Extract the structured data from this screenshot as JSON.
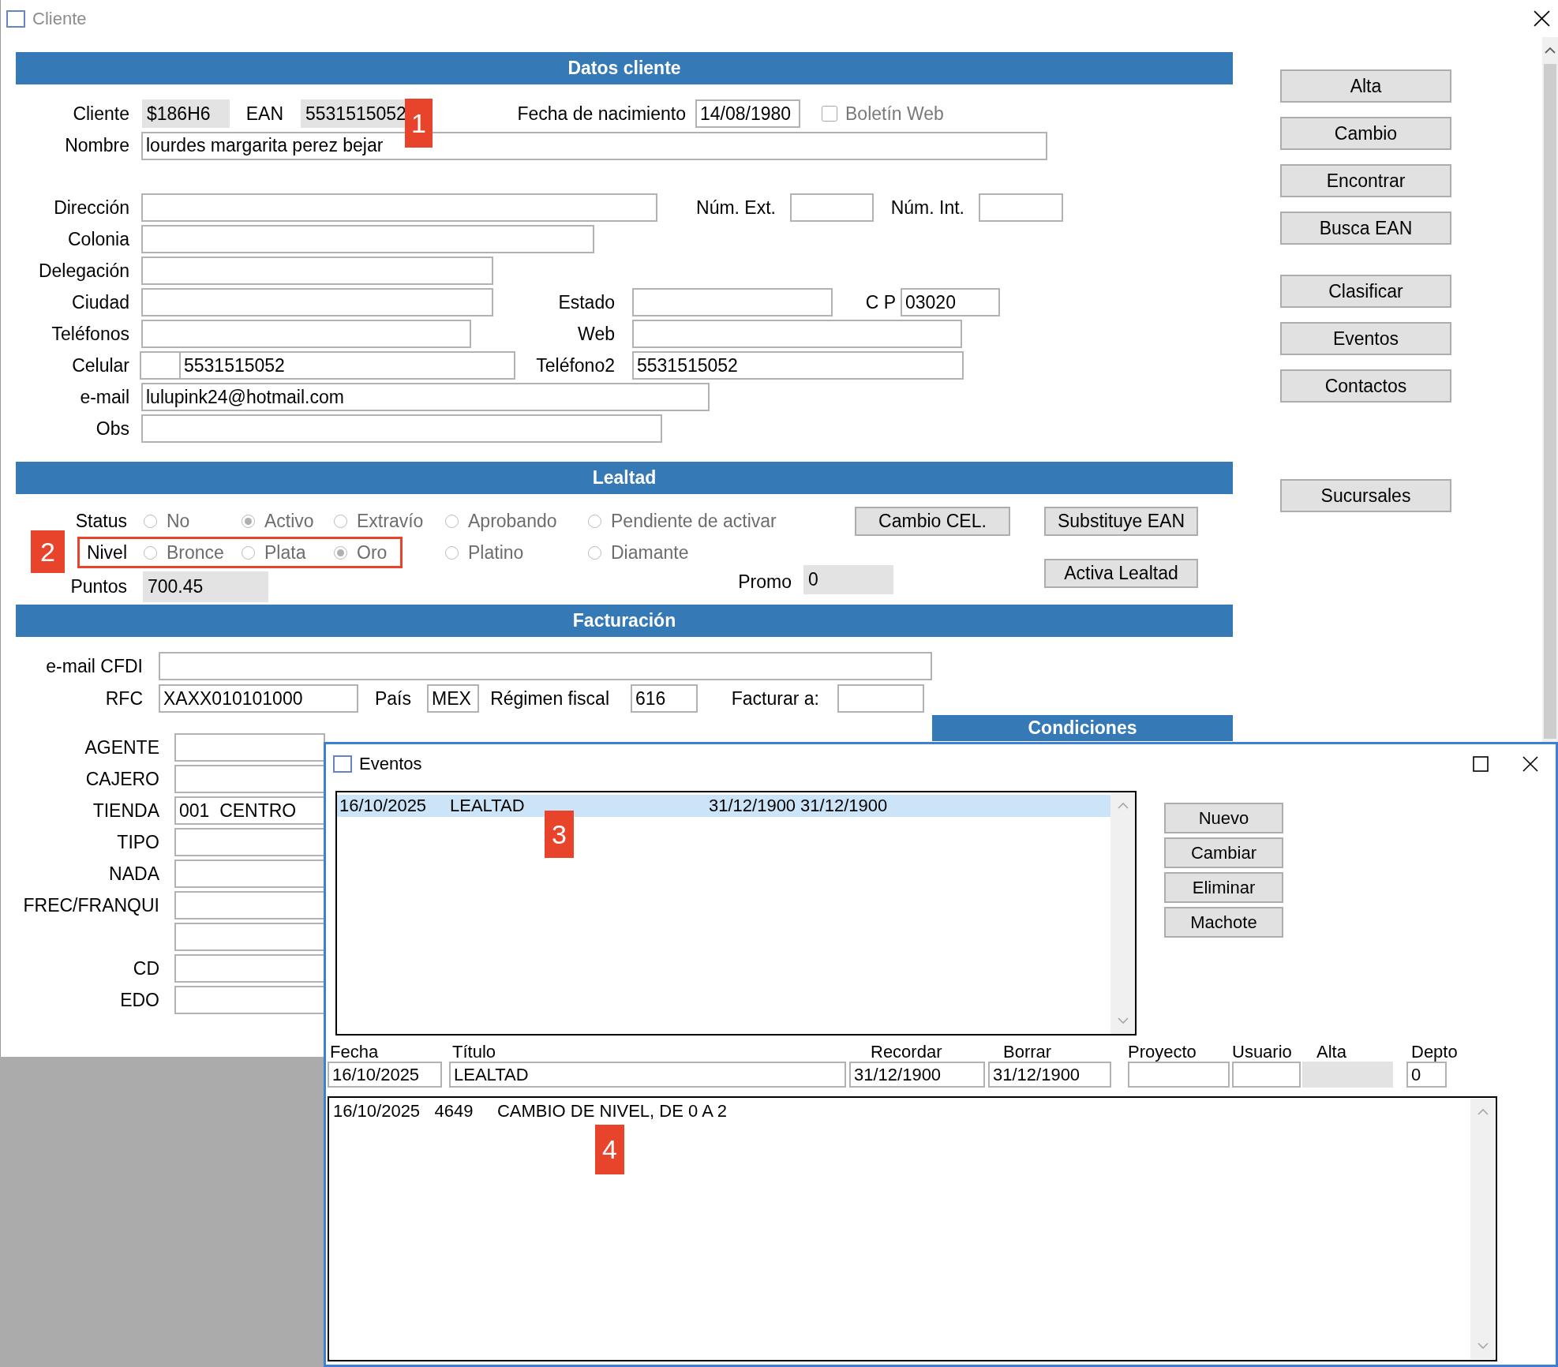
{
  "window": {
    "title": "Cliente",
    "active": false
  },
  "datos_cliente": {
    "title": "Datos cliente",
    "cliente": {
      "label": "Cliente",
      "value": "$186H6",
      "readonly": true
    },
    "ean": {
      "label": "EAN",
      "value": "5531515052",
      "readonly": true,
      "callout": "1"
    },
    "fecha_nacimiento": {
      "label": "Fecha de nacimiento",
      "value": "14/08/1980",
      "readonly": false
    },
    "boletin_web": {
      "label": "Boletín Web",
      "checked": false,
      "disabled": true
    },
    "nombre": {
      "label": "Nombre",
      "value": "lourdes margarita perez bejar",
      "readonly": false
    },
    "direccion": {
      "label": "Dirección",
      "readonly": false
    },
    "num_ext": {
      "label": "Núm. Ext.",
      "readonly": false
    },
    "num_int": {
      "label": "Núm. Int.",
      "readonly": false
    },
    "colonia": {
      "label": "Colonia",
      "readonly": false
    },
    "delegacion": {
      "label": "Delegación",
      "readonly": false
    },
    "ciudad": {
      "label": "Ciudad",
      "readonly": false
    },
    "estado": {
      "label": "Estado",
      "readonly": false
    },
    "cp": {
      "label": "C P",
      "value": "03020",
      "readonly": false
    },
    "telefonos": {
      "label": "Teléfonos",
      "readonly": false
    },
    "web": {
      "label": "Web",
      "readonly": false
    },
    "celular": {
      "label": "Celular",
      "value": "5531515052",
      "readonly": false
    },
    "telefono2": {
      "label": "Teléfono2",
      "value": "5531515052",
      "readonly": false
    },
    "email": {
      "label": "e-mail",
      "value": "lulupink24@hotmail.com",
      "readonly": false
    },
    "obs": {
      "label": "Obs",
      "readonly": false
    }
  },
  "actions": [
    [
      "Alta",
      "Cambio",
      "Encontrar",
      "Busca EAN"
    ],
    [
      "Clasificar",
      "Eventos",
      "Contactos"
    ],
    [
      "Sucursales"
    ]
  ],
  "lealtad": {
    "title": "Lealtad",
    "status": {
      "label": "Status",
      "options": [
        {
          "label": "No",
          "selected": false,
          "disabled": true
        },
        {
          "label": "Activo",
          "selected": true,
          "disabled": true
        },
        {
          "label": "Extravío",
          "selected": false,
          "disabled": true
        },
        {
          "label": "Aprobando",
          "selected": false,
          "disabled": true
        },
        {
          "label": "Pendiente de activar",
          "selected": false,
          "disabled": true
        }
      ]
    },
    "nivel": {
      "label": "Nivel",
      "highlighted": true,
      "callout": "2",
      "options": [
        {
          "label": "Bronce",
          "selected": false,
          "disabled": true
        },
        {
          "label": "Plata",
          "selected": false,
          "disabled": true
        },
        {
          "label": "Oro",
          "selected": true,
          "disabled": true
        },
        {
          "label": "Platino",
          "selected": false,
          "disabled": true
        },
        {
          "label": "Diamante",
          "selected": false,
          "disabled": true
        }
      ]
    },
    "puntos": {
      "label": "Puntos",
      "value": "700.45",
      "readonly": true
    },
    "promo": {
      "label": "Promo",
      "value": "0",
      "readonly": true
    },
    "buttons": [
      "Cambio CEL.",
      "Substituye EAN",
      "Activa Lealtad"
    ]
  },
  "facturacion": {
    "title": "Facturación",
    "email_cfdi": {
      "label": "e-mail  CFDI",
      "readonly": false
    },
    "rfc": {
      "label": "RFC",
      "value": "XAXX010101000",
      "readonly": false
    },
    "pais": {
      "label": "País",
      "value": "MEX",
      "readonly": false
    },
    "regimen_fiscal": {
      "label": "Régimen fiscal",
      "value": "616",
      "readonly": false
    },
    "facturar_a": {
      "label": "Facturar a:",
      "readonly": false
    }
  },
  "condiciones": {
    "title": "Condiciones"
  },
  "asignacion": [
    {
      "label": "AGENTE",
      "readonly": false
    },
    {
      "label": "CAJERO",
      "readonly": false
    },
    {
      "label": "TIENDA",
      "value": "001  CENTRO",
      "readonly": false
    },
    {
      "label": "TIPO",
      "readonly": false
    },
    {
      "label": "NADA",
      "readonly": false
    },
    {
      "label": "FREC/FRANQUI",
      "readonly": false
    },
    {
      "readonly": false
    },
    {
      "label": "CD",
      "readonly": false
    },
    {
      "label": "EDO",
      "readonly": false
    }
  ],
  "eventos": {
    "title": "Eventos",
    "active": true,
    "list": {
      "callout": "3",
      "rows": [
        {
          "fecha": "16/10/2025",
          "titulo": "LEALTAD",
          "recordar": "31/12/1900",
          "borrar": "31/12/1900",
          "selected": true
        }
      ]
    },
    "buttons": [
      "Nuevo",
      "Cambiar",
      "Eliminar",
      "Machote"
    ],
    "fields": [
      {
        "label": "Fecha",
        "value": "16/10/2025",
        "readonly": false
      },
      {
        "label": "Título",
        "value": "LEALTAD",
        "readonly": false
      },
      {
        "label": "Recordar",
        "value": "31/12/1900",
        "readonly": false
      },
      {
        "label": "Borrar",
        "value": "31/12/1900",
        "readonly": false
      },
      {
        "label": "Proyecto",
        "readonly": false
      },
      {
        "label": "Usuario",
        "readonly": false
      },
      {
        "label": "Alta",
        "readonly": true
      },
      {
        "label": "Depto",
        "value": "0",
        "readonly": false
      }
    ],
    "notes": {
      "callout": "4",
      "lines": [
        "16/10/2025   4649     CAMBIO DE NIVEL, DE 0 A 2"
      ]
    }
  }
}
